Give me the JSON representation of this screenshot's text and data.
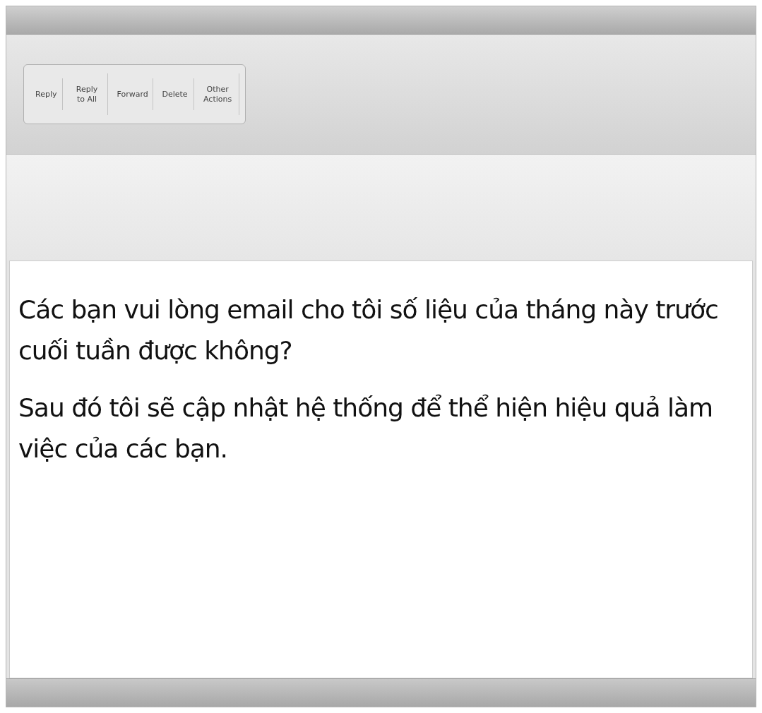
{
  "toolbar": {
    "buttons": [
      {
        "label": "Reply"
      },
      {
        "label": "Reply to All"
      },
      {
        "label": "Forward"
      },
      {
        "label": "Delete"
      },
      {
        "label": "Other Actions"
      }
    ]
  },
  "message": {
    "paragraphs": [
      "Các bạn vui lòng email cho tôi số liệu của tháng này trước cuối tuần được không?",
      "Sau đó tôi sẽ cập nhật hệ thống để thể hiện hiệu quả làm việc của các bạn."
    ]
  }
}
